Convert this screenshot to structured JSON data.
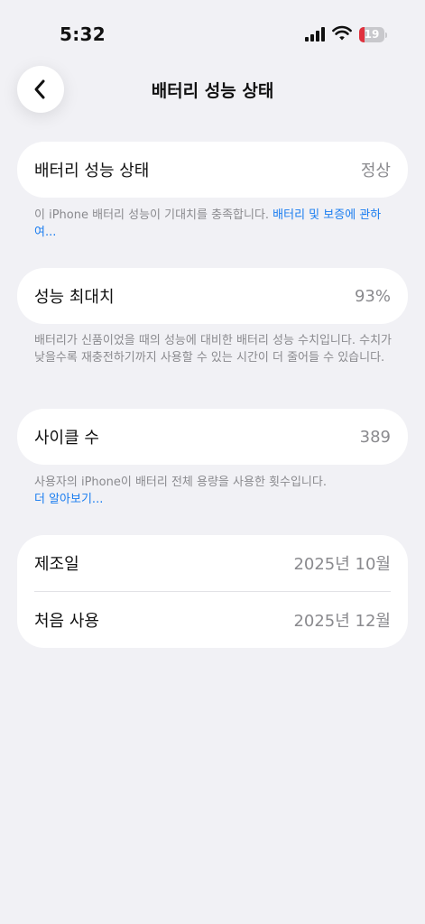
{
  "status_bar": {
    "time": "5:32",
    "battery_level": "19",
    "battery_color": "#e0323e"
  },
  "nav": {
    "title": "배터리 성능 상태",
    "back_icon": "chevron-left-icon"
  },
  "battery_health": {
    "label": "배터리 성능 상태",
    "value": "정상",
    "note_text": "이 iPhone 배터리 성능이 기대치를 충족합니다. ",
    "note_link": "배터리 및 보증에 관하여..."
  },
  "maximum_capacity": {
    "label": "성능 최대치",
    "value": "93%",
    "note_text": "배터리가 신품이었을 때의 성능에 대비한 배터리 성능 수치입니다. 수치가 낮을수록 재충전하기까지 사용할 수 있는 시간이 더 줄어들 수 있습니다."
  },
  "cycle_count": {
    "label": "사이클 수",
    "value": "389",
    "note_text": "사용자의 iPhone이 배터리 전체 용량을 사용한 횟수입니다.",
    "note_link": "더 알아보기..."
  },
  "dates": {
    "manufacture_label": "제조일",
    "manufacture_value": "2025년 10월",
    "first_use_label": "처음 사용",
    "first_use_value": "2025년 12월"
  },
  "colors": {
    "background": "#f1f1f5",
    "link": "#1a7df0",
    "secondary_text": "#8a8a8e"
  }
}
